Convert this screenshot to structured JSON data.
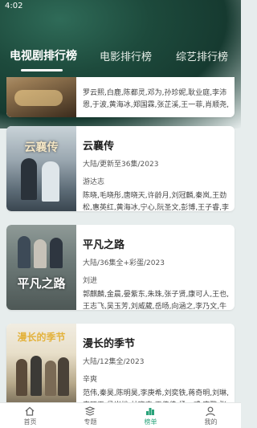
{
  "status_bar": {
    "time": "4:02"
  },
  "tabs": [
    {
      "label": "电视剧排行榜",
      "active": true
    },
    {
      "label": "电影排行榜",
      "active": false
    },
    {
      "label": "综艺排行榜",
      "active": false
    }
  ],
  "cards": [
    {
      "title": "",
      "meta": "",
      "director": "",
      "cast": "罗云熙,白鹿,陈都灵,邓为,孙珍妮,耿业庭,李沛恩,于波,黄海冰,郑国霖,张芷溪,王一菲,肖顺尧,汪"
    },
    {
      "title": "云襄传",
      "meta": "大陆/更新至36集/2023",
      "director": "游达志",
      "cast": "陈晓,毛晓彤,唐晓天,许龄月,刘冠麟,秦岚,王劲松,惠英红,黄海冰,宁心,阮圣文,彭博,王子睿,李洪"
    },
    {
      "title": "平凡之路",
      "meta": "大陆/36集全+彩蛋/2023",
      "director": "刘进",
      "cast": "郭麒麟,金晨,晏紫东,朱珠,张子贤,康可人,王也,王志飞,吴玉芳,刘威葳,岳旸,向涵之,李乃文,牛莉,"
    },
    {
      "title": "漫长的季节",
      "meta": "大陆/12集全/2023",
      "director": "辛爽",
      "cast": "范伟,秦昊,陈明昊,李庚希,刘奕铁,蒋奇明,刘琳,安旺平,侯岩松,林晓杰,王传佳,扬一威,康鹏,张娟"
    }
  ],
  "poster_art": {
    "card2": "云襄传",
    "card3": "平凡之路",
    "card4": "漫长的季节"
  },
  "bottom_nav": [
    {
      "label": "首页",
      "icon": "home-icon",
      "active": false
    },
    {
      "label": "专题",
      "icon": "topic-icon",
      "active": false
    },
    {
      "label": "榜单",
      "icon": "ranking-icon",
      "active": true
    },
    {
      "label": "我的",
      "icon": "profile-icon",
      "active": false
    }
  ],
  "colors": {
    "accent": "#2aa37a",
    "header": "#1d4a3c"
  }
}
